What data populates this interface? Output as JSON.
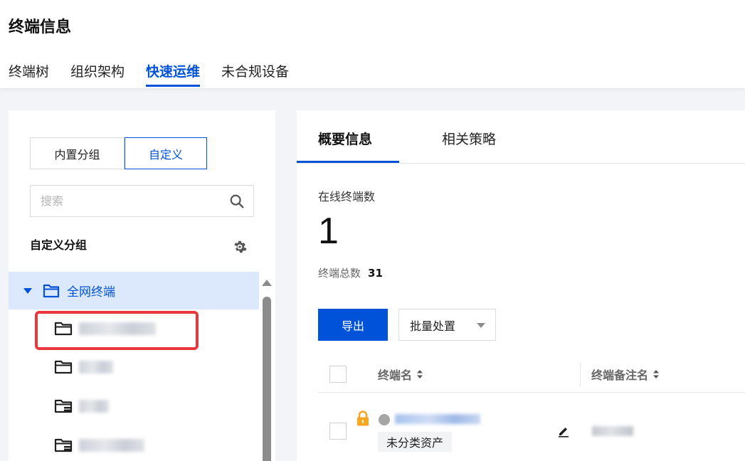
{
  "page": {
    "title": "终端信息"
  },
  "top_tabs": [
    {
      "label": "终端树",
      "active": false
    },
    {
      "label": "组织架构",
      "active": false
    },
    {
      "label": "快速运维",
      "active": true
    },
    {
      "label": "未合规设备",
      "active": false
    }
  ],
  "sidebar": {
    "segment": {
      "builtin": "内置分组",
      "custom": "自定义",
      "active": "custom"
    },
    "search": {
      "placeholder": "搜索",
      "value": ""
    },
    "group_title": "自定义分组",
    "tree": {
      "root_label": "全网终端",
      "children": [
        {
          "icon": "folder-icon"
        },
        {
          "icon": "folder-icon"
        },
        {
          "icon": "shared-folder-icon"
        },
        {
          "icon": "shared-folder-icon"
        }
      ]
    }
  },
  "detail": {
    "tabs": [
      {
        "label": "概要信息",
        "active": true
      },
      {
        "label": "相关策略",
        "active": false
      }
    ],
    "online_label": "在线终端数",
    "online_value": "1",
    "total_label": "终端总数",
    "total_value": "31",
    "export_label": "导出",
    "batch_label": "批量处置",
    "table": {
      "columns": [
        "终端名",
        "终端备注名"
      ],
      "rows": [
        {
          "tag": "未分类资产",
          "status": "offline"
        }
      ]
    }
  },
  "colors": {
    "primary": "#0052d9",
    "highlight": "#e8383d",
    "lock": "#f5a623"
  }
}
